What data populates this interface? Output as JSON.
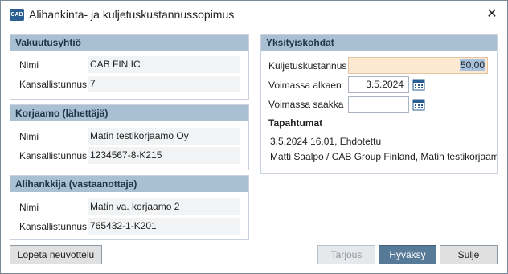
{
  "window": {
    "title": "Alihankinta- ja kuljetuskustannussopimus",
    "app_icon_text": "CAB",
    "close_glyph": "✕"
  },
  "insurer": {
    "heading": "Vakuutusyhtiö",
    "name_label": "Nimi",
    "name_value": "CAB FIN IC",
    "reg_label": "Kansallistunnus",
    "reg_value": "7"
  },
  "workshop": {
    "heading": "Korjaamo (lähettäjä)",
    "name_label": "Nimi",
    "name_value": "Matin testikorjaamo Oy",
    "reg_label": "Kansallistunnus",
    "reg_value": "1234567-8-K215"
  },
  "subcontractor": {
    "heading": "Alihankkija (vastaanottaja)",
    "name_label": "Nimi",
    "name_value": "Matin va. korjaamo 2",
    "reg_label": "Kansallistunnus",
    "reg_value": "765432-1-K201"
  },
  "details": {
    "heading": "Yksityiskohdat",
    "cost_label": "Kuljetuskustannus",
    "cost_value": "50,00",
    "valid_from_label": "Voimassa alkaen",
    "valid_from_value": "3.5.2024",
    "valid_to_label": "Voimassa saakka",
    "valid_to_value": "",
    "events_heading": "Tapahtumat",
    "event_line1": "3.5.2024 16.01, Ehdotettu",
    "event_line2": "Matti Saalpo / CAB Group Finland, Matin testikorjaamo"
  },
  "buttons": {
    "end_negotiation": "Lopeta neuvottelu",
    "offer": "Tarjous",
    "accept": "Hyväksy",
    "close": "Sulje"
  },
  "colors": {
    "panel_header": "#a9bfd2",
    "accept_button": "#587a99",
    "cost_field": "#fde8d2"
  }
}
